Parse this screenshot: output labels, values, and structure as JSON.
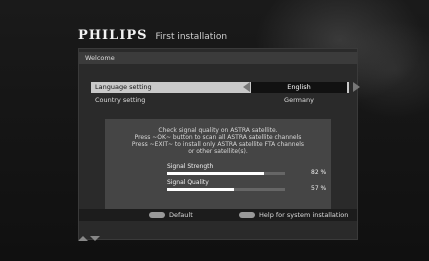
{
  "header": {
    "brand": "PHILIPS",
    "title": "First installation"
  },
  "welcome": "Welcome",
  "settings": {
    "language": {
      "label": "Language setting",
      "value": "English"
    },
    "country": {
      "label": "Country setting",
      "value": "Germany"
    }
  },
  "info": {
    "lines": [
      "Check signal quality on ASTRA satellite.",
      "Press ~OK~ button to scan all ASTRA satellite channels",
      "Press ~EXIT~ to install only ASTRA satellite FTA channels",
      "or other satellite(s)."
    ]
  },
  "signal": {
    "strength": {
      "label": "Signal Strength",
      "value_text": "82 %",
      "percent": 82
    },
    "quality": {
      "label": "Signal Quality",
      "value_text": "57 %",
      "percent": 57
    }
  },
  "footer": {
    "default_label": "Default",
    "help_label": "Help for system installation"
  },
  "icons": {
    "left_arrow": "triangle-left-icon",
    "right_arrow": "triangle-right-icon",
    "nav_up": "triangle-up-icon",
    "nav_down": "triangle-down-icon"
  }
}
